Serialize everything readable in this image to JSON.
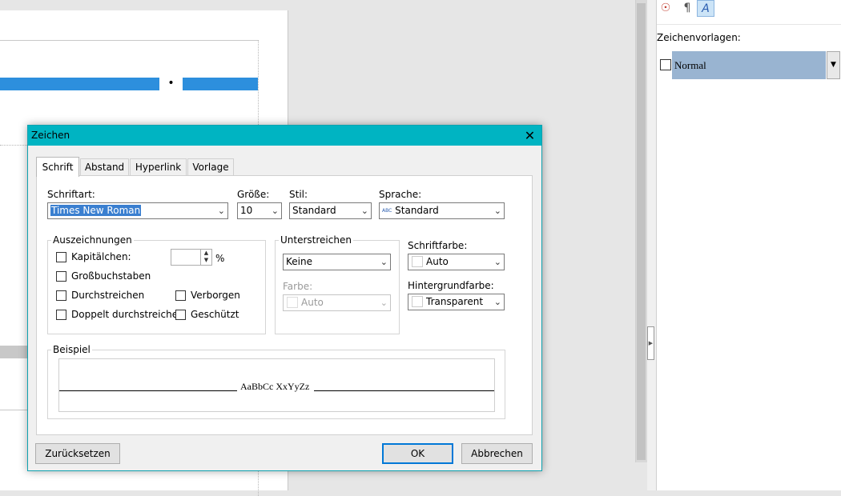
{
  "sidebar": {
    "tools": [
      {
        "icon": "navigator-icon",
        "glyph": "☉"
      },
      {
        "icon": "paragraph-styles-icon",
        "glyph": "¶"
      },
      {
        "icon": "character-styles-icon",
        "glyph": "A"
      }
    ],
    "title": "Zeichenvorlagen:",
    "items": [
      {
        "label": "Normal",
        "selected": true
      }
    ]
  },
  "document": {
    "marker": "•"
  },
  "dialog": {
    "title": "Zeichen",
    "close_glyph": "✕",
    "tabs": [
      {
        "label": "Schrift",
        "active": true
      },
      {
        "label": "Abstand",
        "active": false
      },
      {
        "label": "Hyperlink",
        "active": false
      },
      {
        "label": "Vorlage",
        "active": false
      }
    ],
    "font": {
      "schriftart_label": "Schriftart:",
      "schriftart_value": "Times New Roman",
      "groesse_label": "Größe:",
      "groesse_value": "10",
      "stil_label": "Stil:",
      "stil_value": "Standard",
      "sprache_label": "Sprache:",
      "sprache_value": "Standard",
      "sprache_icon": "ABC"
    },
    "auszeichnungen": {
      "title": "Auszeichnungen",
      "kapitaelchen": "Kapitälchen:",
      "kapitaelchen_value": "",
      "percent": "%",
      "grossbuchstaben": "Großbuchstaben",
      "durchstreichen": "Durchstreichen",
      "doppelt": "Doppelt durchstreichen",
      "verborgen": "Verborgen",
      "geschuetzt": "Geschützt"
    },
    "unterstreichen": {
      "title": "Unterstreichen",
      "value": "Keine",
      "farbe_label": "Farbe:",
      "farbe_value": "Auto"
    },
    "schriftfarbe": {
      "label": "Schriftfarbe:",
      "value": "Auto"
    },
    "hintergrundfarbe": {
      "label": "Hintergrundfarbe:",
      "value": "Transparent"
    },
    "beispiel": {
      "title": "Beispiel",
      "text": "AaBbCc XxYyZz"
    },
    "buttons": {
      "reset": "Zurücksetzen",
      "ok": "OK",
      "cancel": "Abbrechen"
    }
  },
  "colors": {
    "titlebar": "#00b4c2",
    "selection": "#2d8fdd",
    "style_selected": "#99b4d1"
  }
}
